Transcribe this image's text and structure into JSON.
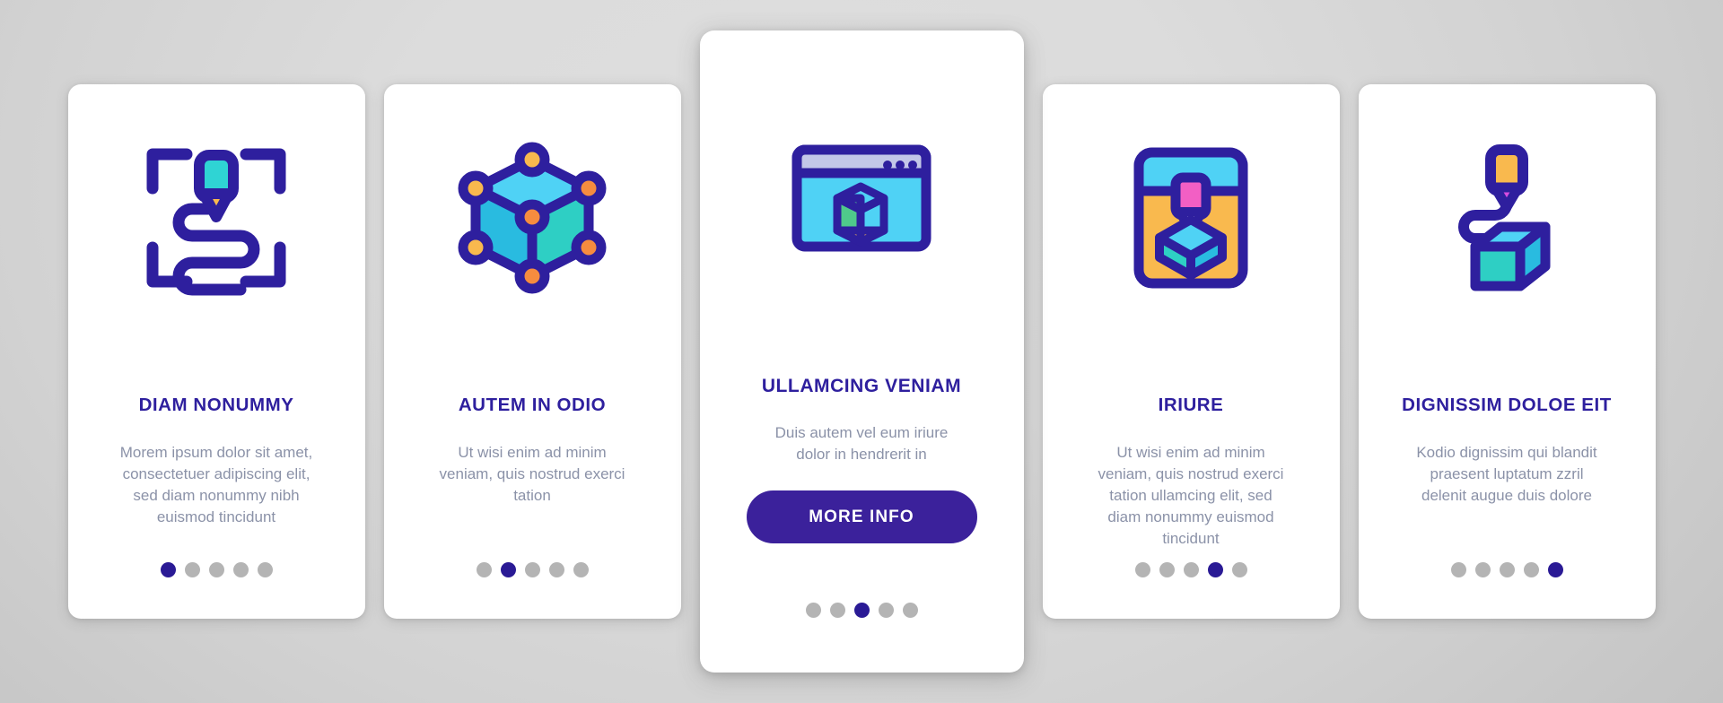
{
  "theme": {
    "accent": "#2e1f9e",
    "button_bg": "#3b219b",
    "body_text_color": "#8b92a8",
    "dot_inactive": "#b4b4b4",
    "dot_active": "#2a1a95",
    "card_bg": "#ffffff",
    "page_bg": "#d6d6d6",
    "icon_stroke": "#2e1f9e",
    "icon_cyan": "#5ce1e6",
    "icon_blue": "#4fd2f5",
    "icon_teal": "#2ec5c5",
    "icon_orange": "#f9b94e",
    "icon_orange_dark": "#f68c3f",
    "icon_pink": "#f25fc4",
    "icon_green": "#4fc98b",
    "icon_magenta": "#d84ce0",
    "icon_lavender": "#c3c7e8"
  },
  "cards": [
    {
      "id": "diam-nonummy",
      "icon_name": "print-scan-path-icon",
      "title": "DIAM NONUMMY",
      "body": "Morem ipsum dolor sit amet, consectetuer adipiscing elit, sed diam nonummy nibh euismod tincidunt",
      "featured": false,
      "dots": {
        "count": 5,
        "active_index": 0
      },
      "cta": null
    },
    {
      "id": "autem-in-odio",
      "icon_name": "cube-nodes-icon",
      "title": "AUTEM IN ODIO",
      "body": "Ut wisi enim ad minim veniam, quis nostrud exerci tation",
      "featured": false,
      "dots": {
        "count": 5,
        "active_index": 1
      },
      "cta": null
    },
    {
      "id": "ullamcing-veniam",
      "icon_name": "browser-cube-icon",
      "title": "ULLAMCING VENIAM",
      "body": "Duis autem vel eum iriure dolor in hendrerit in",
      "featured": true,
      "dots": {
        "count": 5,
        "active_index": 2
      },
      "cta": "MORE INFO"
    },
    {
      "id": "iriure",
      "icon_name": "printer-cube-icon",
      "title": "IRIURE",
      "body": "Ut wisi enim ad minim veniam, quis nostrud exerci tation ullamcing elit, sed diam nonummy euismod tincidunt",
      "featured": false,
      "dots": {
        "count": 5,
        "active_index": 3
      },
      "cta": null
    },
    {
      "id": "dignissim-doloe-eit",
      "icon_name": "extruder-cube-icon",
      "title": "DIGNISSIM DOLOE EIT",
      "body": "Kodio dignissim qui blandit praesent luptatum zzril delenit augue duis dolore",
      "featured": false,
      "dots": {
        "count": 5,
        "active_index": 4
      },
      "cta": null
    }
  ]
}
